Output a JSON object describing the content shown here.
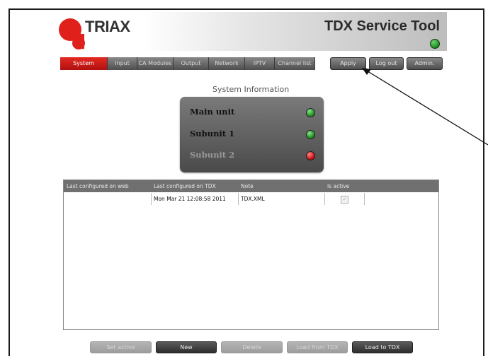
{
  "header": {
    "logo_text": "TRIAX",
    "app_title": "TDX Service Tool",
    "colors": {
      "brand_red": "#e0201b",
      "status_green": "#1e8a1e"
    }
  },
  "nav": {
    "tabs": [
      {
        "label": "System",
        "active": true
      },
      {
        "label": "Input",
        "active": false
      },
      {
        "label": "CA Modules",
        "active": false
      },
      {
        "label": "Output",
        "active": false
      },
      {
        "label": "Network",
        "active": false
      },
      {
        "label": "IPTV",
        "active": false
      },
      {
        "label": "Channel list",
        "active": false
      }
    ],
    "apply_label": "Apply",
    "logout_label": "Log out",
    "admin_label": "Admin."
  },
  "system_info": {
    "title": "System Information",
    "units": [
      {
        "name": "Main unit",
        "status": "green",
        "enabled": true
      },
      {
        "name": "Subunit 1",
        "status": "green",
        "enabled": true
      },
      {
        "name": "Subunit 2",
        "status": "red",
        "enabled": false
      }
    ]
  },
  "config_table": {
    "headers": [
      "Last configured on web",
      "Last configured on TDX",
      "Note",
      "Is active"
    ],
    "rows": [
      {
        "web": "",
        "tdx": "Mon Mar 21 12:08:58 2011",
        "note": "TDX.XML",
        "is_active": true
      }
    ]
  },
  "actions": {
    "set_active": "Set active",
    "new": "New",
    "delete": "Delete",
    "load_from_tdx": "Load from TDX",
    "load_to_tdx": "Load to TDX"
  }
}
